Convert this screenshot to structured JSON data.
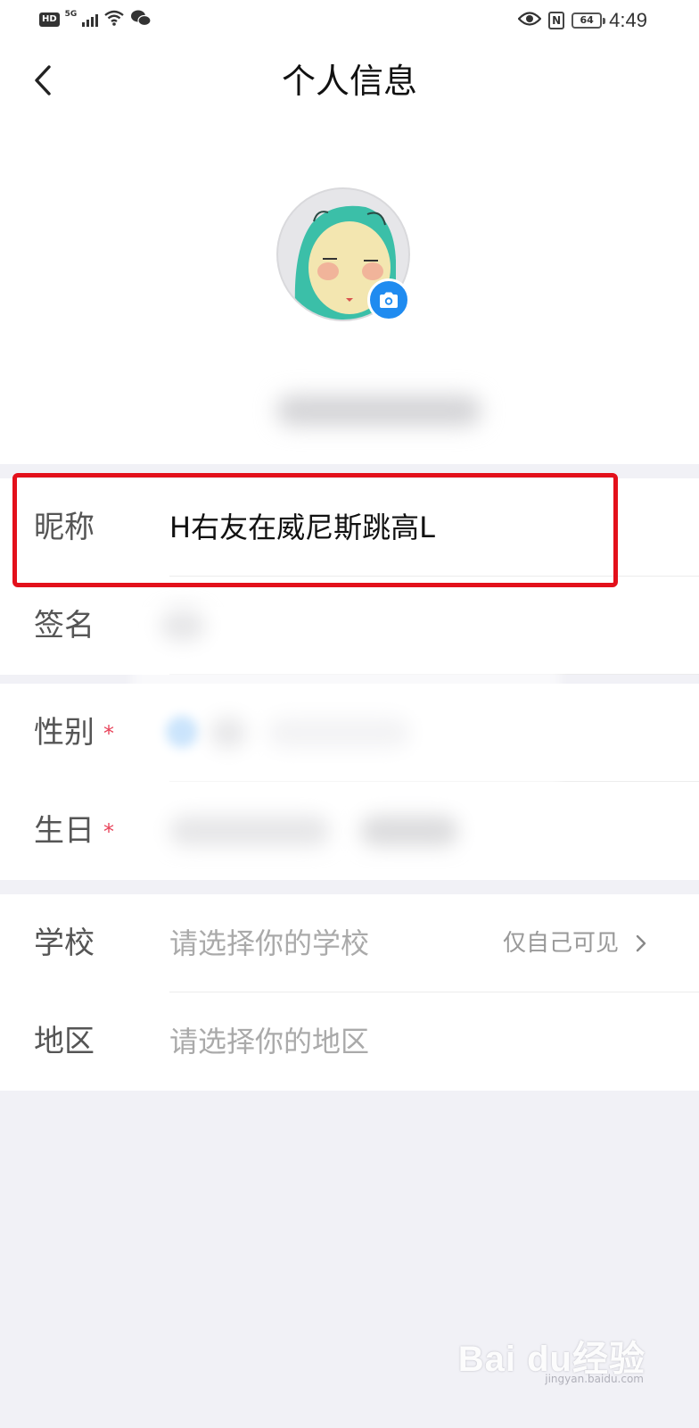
{
  "status_bar": {
    "hd": "HD",
    "network": "5G",
    "battery": "64",
    "nfc": "N",
    "time": "4:49"
  },
  "header": {
    "title": "个人信息"
  },
  "form": {
    "nickname": {
      "label": "昵称",
      "value": "H右友在威尼斯跳高L"
    },
    "signature": {
      "label": "签名"
    },
    "gender": {
      "label": "性别",
      "required_mark": "*"
    },
    "birthday": {
      "label": "生日",
      "required_mark": "*"
    },
    "school": {
      "label": "学校",
      "placeholder": "请选择你的学校",
      "note": "仅自己可见"
    },
    "region": {
      "label": "地区",
      "placeholder": "请选择你的地区"
    }
  },
  "watermark": {
    "brand": "Bai du经验",
    "url": "jingyan.baidu.com"
  },
  "colors": {
    "accent_blue": "#1f8bf0",
    "required_red": "#e8435a",
    "highlight_red": "#e3101b",
    "page_bg": "#f1f1f6"
  }
}
